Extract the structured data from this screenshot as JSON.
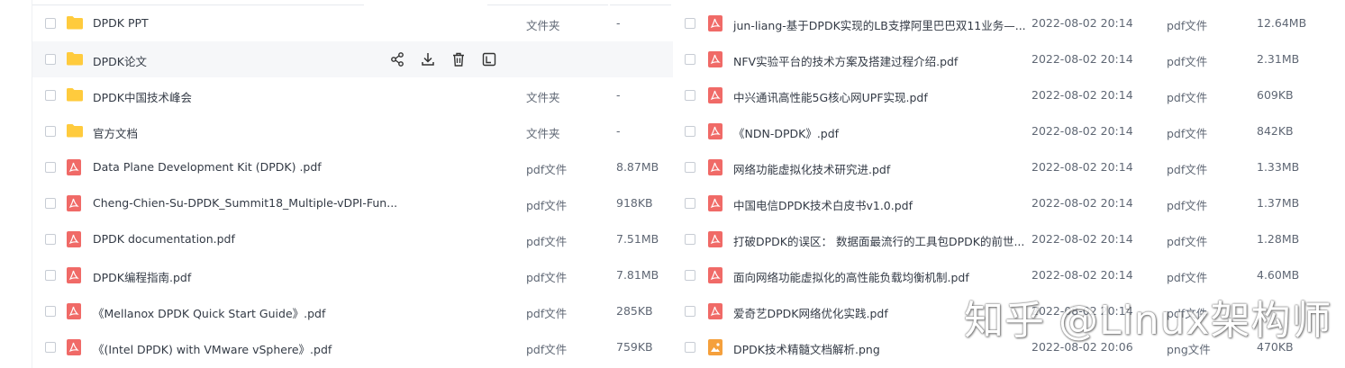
{
  "left_rows": [
    {
      "name": "DPDK  PPT",
      "type": "文件夹",
      "size": "-",
      "icon": "folder-icon"
    },
    {
      "name": "DPDK论文",
      "type": "",
      "size": "",
      "icon": "folder-icon",
      "hover": true
    },
    {
      "name": "DPDK中国技术峰会",
      "type": "文件夹",
      "size": "-",
      "icon": "folder-icon"
    },
    {
      "name": "官方文档",
      "type": "文件夹",
      "size": "-",
      "icon": "folder-icon"
    },
    {
      "name": "Data Plane Development Kit (DPDK) .pdf",
      "type": "pdf文件",
      "size": "8.87MB",
      "icon": "pdf-icon"
    },
    {
      "name": "Cheng-Chien-Su-DPDK_Summit18_Multiple-vDPI-Fun...",
      "type": "pdf文件",
      "size": "918KB",
      "icon": "pdf-icon"
    },
    {
      "name": "DPDK documentation.pdf",
      "type": "pdf文件",
      "size": "7.51MB",
      "icon": "pdf-icon"
    },
    {
      "name": "DPDK编程指南.pdf",
      "type": "pdf文件",
      "size": "7.81MB",
      "icon": "pdf-icon"
    },
    {
      "name": "《Mellanox DPDK Quick Start Guide》.pdf",
      "type": "pdf文件",
      "size": "285KB",
      "icon": "pdf-icon"
    },
    {
      "name": "《(Intel DPDK) with VMware vSphere》.pdf",
      "type": "pdf文件",
      "size": "759KB",
      "icon": "pdf-icon"
    }
  ],
  "right_rows": [
    {
      "name": "jun-liang-基于DPDK实现的LB支撑阿里巴巴双11业务—...",
      "date": "2022-08-02 20:14",
      "type": "pdf文件",
      "size": "12.64MB",
      "icon": "pdf-icon"
    },
    {
      "name": "NFV实验平台的技术方案及搭建过程介绍.pdf",
      "date": "2022-08-02 20:14",
      "type": "pdf文件",
      "size": "2.31MB",
      "icon": "pdf-icon"
    },
    {
      "name": "中兴通讯高性能5G核心网UPF实现.pdf",
      "date": "2022-08-02 20:14",
      "type": "pdf文件",
      "size": "609KB",
      "icon": "pdf-icon"
    },
    {
      "name": "《NDN-DPDK》.pdf",
      "date": "2022-08-02 20:14",
      "type": "pdf文件",
      "size": "842KB",
      "icon": "pdf-icon"
    },
    {
      "name": "网络功能虚拟化技术研究进.pdf",
      "date": "2022-08-02 20:14",
      "type": "pdf文件",
      "size": "1.33MB",
      "icon": "pdf-icon"
    },
    {
      "name": "中国电信DPDK技术白皮书v1.0.pdf",
      "date": "2022-08-02 20:14",
      "type": "pdf文件",
      "size": "1.37MB",
      "icon": "pdf-icon"
    },
    {
      "name": "打破DPDK的误区： 数据面最流行的工具包DPDK的前世...",
      "date": "2022-08-02 20:14",
      "type": "pdf文件",
      "size": "1.28MB",
      "icon": "pdf-icon"
    },
    {
      "name": "面向网络功能虚拟化的高性能负载均衡机制.pdf",
      "date": "2022-08-02 20:14",
      "type": "pdf文件",
      "size": "4.60MB",
      "icon": "pdf-icon"
    },
    {
      "name": "爱奇艺DPDK网络优化实践.pdf",
      "date": "2022-08-02 20:14",
      "type": "pdf文件",
      "size": "",
      "icon": "pdf-icon"
    },
    {
      "name": "DPDK技术精髓文档解析.png",
      "date": "2022-08-02 20:06",
      "type": "png文件",
      "size": "470KB",
      "icon": "image-icon"
    }
  ],
  "hover_actions": [
    "share-icon",
    "download-icon",
    "delete-icon",
    "rename-icon"
  ],
  "watermark": "知乎 @Linux架构师",
  "colors": {
    "folder": "#ffcb3d",
    "pdf": "#f06a67",
    "png": "#f5a03c"
  }
}
